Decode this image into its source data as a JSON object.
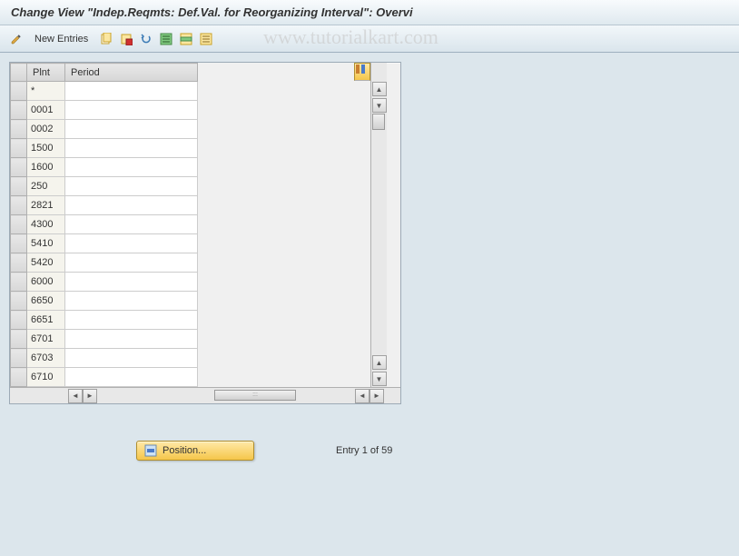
{
  "title": "Change View \"Indep.Reqmts: Def.Val. for Reorganizing Interval\": Overvi",
  "watermark": "www.tutorialkart.com",
  "toolbar": {
    "new_entries_label": "New Entries"
  },
  "table": {
    "columns": {
      "col1": "Plnt",
      "col2": "Period"
    },
    "rows": [
      {
        "plnt": "*",
        "period": ""
      },
      {
        "plnt": "0001",
        "period": ""
      },
      {
        "plnt": "0002",
        "period": ""
      },
      {
        "plnt": "1500",
        "period": ""
      },
      {
        "plnt": "1600",
        "period": ""
      },
      {
        "plnt": "250",
        "period": ""
      },
      {
        "plnt": "2821",
        "period": ""
      },
      {
        "plnt": "4300",
        "period": ""
      },
      {
        "plnt": "5410",
        "period": ""
      },
      {
        "plnt": "5420",
        "period": ""
      },
      {
        "plnt": "6000",
        "period": ""
      },
      {
        "plnt": "6650",
        "period": ""
      },
      {
        "plnt": "6651",
        "period": ""
      },
      {
        "plnt": "6701",
        "period": ""
      },
      {
        "plnt": "6703",
        "period": ""
      },
      {
        "plnt": "6710",
        "period": ""
      }
    ]
  },
  "footer": {
    "position_label": "Position...",
    "entry_text": "Entry 1 of 59"
  }
}
